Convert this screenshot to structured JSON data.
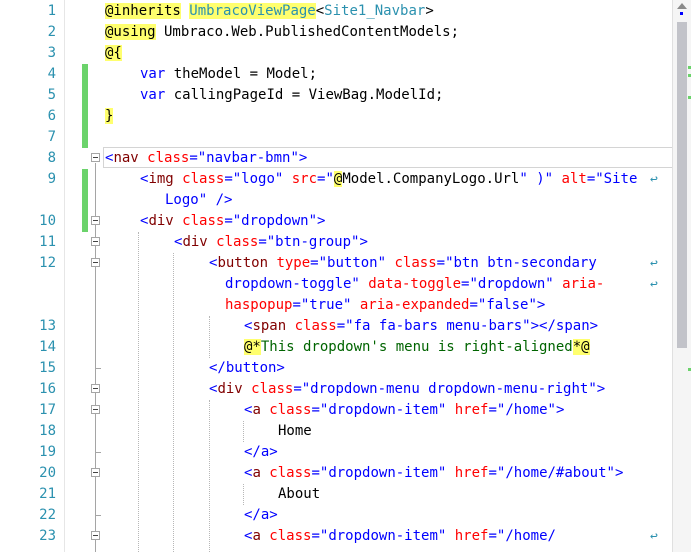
{
  "line_numbers": [
    "1",
    "2",
    "3",
    "4",
    "5",
    "6",
    "7",
    "8",
    "9",
    "",
    "10",
    "11",
    "12",
    "",
    "",
    "13",
    "14",
    "15",
    "16",
    "17",
    "18",
    "19",
    "20",
    "21",
    "22",
    "23"
  ],
  "colors": {
    "line_number": "#2b91af",
    "razor_highlight": "#ffff6e",
    "keyword": "#0000ff",
    "html_tag": "#800000",
    "html_attr": "#ff0000",
    "string": "#0000ff",
    "type": "#2b91af",
    "comment": "#006400",
    "change_bar": "#6bd36b"
  },
  "code": {
    "l1": {
      "directive": "@inherits",
      "class": "UmbracoViewPage",
      "lt": "<",
      "generic": "Site1_Navbar",
      "gt": ">"
    },
    "l2": {
      "directive": "@using",
      "ns": " Umbraco.Web.PublishedContentModels;"
    },
    "l3": {
      "open": "@{"
    },
    "l4": {
      "kw": "var",
      "rest": " theModel = Model;"
    },
    "l5": {
      "kw": "var",
      "rest": " callingPageId = ViewBag.ModelId;"
    },
    "l6": {
      "close": "}"
    },
    "l8": {
      "lt": "<",
      "tag": "nav",
      "attr": " class",
      "eq": "=",
      "val": "\"navbar-bmn\"",
      "gt": ">"
    },
    "l9a": {
      "lt": "<",
      "tag": "img",
      "a1": " class",
      "eq1": "=",
      "v1": "\"logo\"",
      "a2": " src",
      "eq2": "=",
      "q": "\"",
      "at": "@",
      "expr": "Model.CompanyLogo.Url",
      "q2": "\" )\"",
      "a3": " alt",
      "eq3": "=",
      "v3": "\"Site"
    },
    "l9b": {
      "v": "Logo\"",
      "end": " />"
    },
    "l10": {
      "lt": "<",
      "tag": "div",
      "attr": " class",
      "eq": "=",
      "val": "\"dropdown\"",
      "gt": ">"
    },
    "l11": {
      "lt": "<",
      "tag": "div",
      "attr": " class",
      "eq": "=",
      "val": "\"btn-group\"",
      "gt": ">"
    },
    "l12a": {
      "lt": "<",
      "tag": "button",
      "a1": " type",
      "eq1": "=",
      "v1": "\"button\"",
      "a2": " class",
      "eq2": "=",
      "v2": "\"btn btn-secondary"
    },
    "l12b": {
      "v": "dropdown-toggle\"",
      "a3": " data-toggle",
      "eq3": "=",
      "v3": "\"dropdown\"",
      "a4": " aria-"
    },
    "l12c": {
      "a": "haspopup",
      "eq": "=",
      "v": "\"true\"",
      "a2": " aria-expanded",
      "eq2": "=",
      "v2": "\"false\"",
      "gt": ">"
    },
    "l13": {
      "lt": "<",
      "tag": "span",
      "attr": " class",
      "eq": "=",
      "val": "\"fa fa-bars menu-bars\"",
      "gt": ">",
      "close": "</span>"
    },
    "l14": {
      "open": "@*",
      "text": "This dropdown's menu is right-aligned",
      "close": "*@"
    },
    "l15": {
      "close": "</button>"
    },
    "l16": {
      "lt": "<",
      "tag": "div",
      "attr": " class",
      "eq": "=",
      "val": "\"dropdown-menu dropdown-menu-right\"",
      "gt": ">"
    },
    "l17": {
      "lt": "<",
      "tag": "a",
      "a1": " class",
      "eq1": "=",
      "v1": "\"dropdown-item\"",
      "a2": " href",
      "eq2": "=",
      "v2": "\"/home\"",
      "gt": ">"
    },
    "l18": {
      "text": "Home"
    },
    "l19": {
      "close": "</a>"
    },
    "l20": {
      "lt": "<",
      "tag": "a",
      "a1": " class",
      "eq1": "=",
      "v1": "\"dropdown-item\"",
      "a2": " href",
      "eq2": "=",
      "v2": "\"/home/#about\"",
      "gt": ">"
    },
    "l21": {
      "text": "About"
    },
    "l22": {
      "close": "</a>"
    },
    "l23": {
      "lt": "<",
      "tag": "a",
      "a1": " class",
      "eq1": "=",
      "v1": "\"dropdown-item\"",
      "a2": " href",
      "eq2": "=",
      "v2": "\"/home/"
    }
  }
}
